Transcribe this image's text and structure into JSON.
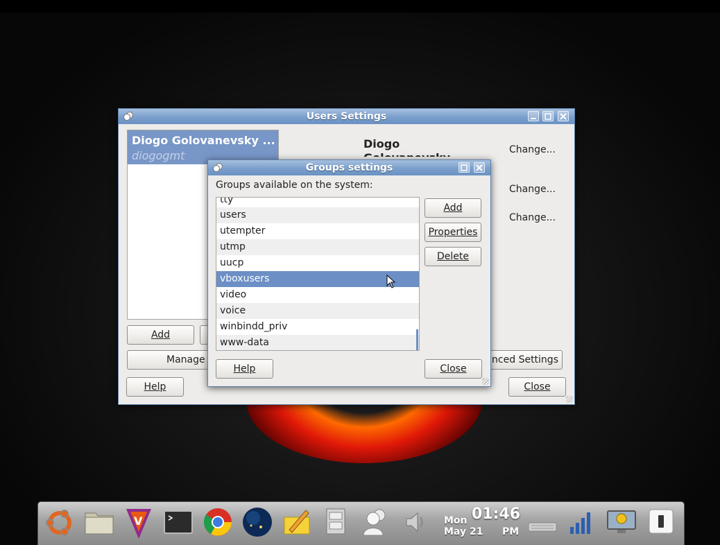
{
  "users_window": {
    "title": "Users Settings",
    "selected_user": {
      "name": "Diogo Golovanevsky ...",
      "login": "diogogmt"
    },
    "detail_name": "Diogo Golovanevsky Monteiro",
    "change_labels": [
      "Change...",
      "Change...",
      "Change..."
    ],
    "add_label": "Add",
    "manage_label": "Manage G",
    "advanced_label": "anced Settings",
    "help_label": "Help",
    "close_label": "Close"
  },
  "groups_window": {
    "title": "Groups settings",
    "heading": "Groups available on the system:",
    "groups": [
      "tty",
      "users",
      "utempter",
      "utmp",
      "uucp",
      "vboxusers",
      "video",
      "voice",
      "winbindd_priv",
      "www-data"
    ],
    "selected_group": "vboxusers",
    "add_label": "Add",
    "properties_label": "Properties",
    "delete_label": "Delete",
    "help_label": "Help",
    "close_label": "Close"
  },
  "dock": {
    "apps": [
      "ubuntu-logo-icon",
      "files-icon",
      "vlc-icon",
      "terminal-icon",
      "chrome-icon",
      "earth-icon",
      "notes-icon",
      "file-cabinet-icon",
      "users-icon",
      "volume-icon"
    ],
    "clock": {
      "day": "Mon",
      "date": "May 21",
      "time": "01:46",
      "ampm": "PM"
    },
    "tray": [
      "keyboard-icon",
      "signal-icon",
      "monitor-icon",
      "power-icon"
    ]
  },
  "colors": {
    "selection": "#6c8fc5",
    "titlebar": "#7a9fcc",
    "user_selection": "#7896c7"
  }
}
